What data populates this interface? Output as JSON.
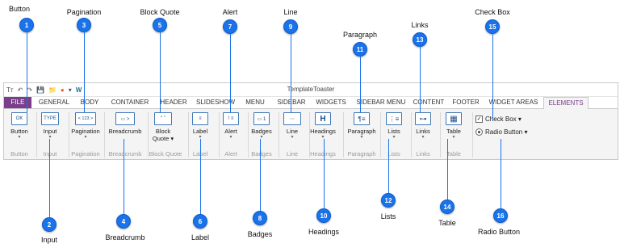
{
  "app": {
    "title": "TemplateToaster",
    "quick_access": [
      "Tт",
      "↶",
      "↷",
      "💾",
      "📁",
      "●",
      "▾",
      "W"
    ]
  },
  "tabs": [
    {
      "label": "FILE"
    },
    {
      "label": "GENERAL"
    },
    {
      "label": "BODY"
    },
    {
      "label": "CONTAINER"
    },
    {
      "label": "HEADER"
    },
    {
      "label": "SLIDESHOW"
    },
    {
      "label": "MENU"
    },
    {
      "label": "SIDEBAR"
    },
    {
      "label": "WIDGETS"
    },
    {
      "label": "SIDEBAR MENU"
    },
    {
      "label": "CONTENT"
    },
    {
      "label": "FOOTER"
    },
    {
      "label": "WIDGET AREAS"
    },
    {
      "label": "ELEMENTS"
    }
  ],
  "ribbon": {
    "button": {
      "icon": "OK",
      "label": "Button",
      "group": "Button"
    },
    "input": {
      "icon": "TYPE",
      "label": "Input",
      "group": "Input"
    },
    "pagination": {
      "icon": "< 123 >",
      "label": "Pagination",
      "group": "Pagination"
    },
    "breadcrumb": {
      "icon": "▭ >",
      "label": "Breadcrumb",
      "group": "Breadcrumb"
    },
    "blockquote": {
      "icon": "“ ”",
      "label1": "Block",
      "label2": "Quote ▾",
      "group": "Block Quote"
    },
    "label": {
      "icon": "≡",
      "label": "Label",
      "group": "Label"
    },
    "alert": {
      "icon": "! ≡",
      "label": "Alert",
      "group": "Alert"
    },
    "badges": {
      "icon": "▭ 1",
      "label": "Badges",
      "group": "Badges"
    },
    "line": {
      "icon": "⋯",
      "label": "Line",
      "group": "Line"
    },
    "headings": {
      "icon": "H",
      "label": "Headings",
      "group": "Headings"
    },
    "paragraph": {
      "icon": "¶≡",
      "label": "Paragraph",
      "group": "Paragraph"
    },
    "lists": {
      "icon": "⋮≡",
      "label": "Lists",
      "group": "Lists"
    },
    "links": {
      "icon": "⊶",
      "label": "Links",
      "group": "Links"
    },
    "table": {
      "icon": "▦",
      "label": "Table",
      "group": "Table"
    },
    "checkbox": {
      "label": "Check Box ▾"
    },
    "radio": {
      "label": "Radio Button ▾"
    }
  },
  "callouts": [
    {
      "n": "1",
      "text": "Button"
    },
    {
      "n": "2",
      "text": "Input"
    },
    {
      "n": "3",
      "text": "Pagination"
    },
    {
      "n": "4",
      "text": "Breadcrumb"
    },
    {
      "n": "5",
      "text": "Block Quote"
    },
    {
      "n": "6",
      "text": "Label"
    },
    {
      "n": "7",
      "text": "Alert"
    },
    {
      "n": "8",
      "text": "Badges"
    },
    {
      "n": "9",
      "text": "Line"
    },
    {
      "n": "10",
      "text": "Headings"
    },
    {
      "n": "11",
      "text": "Paragraph"
    },
    {
      "n": "12",
      "text": "Lists"
    },
    {
      "n": "13",
      "text": "Links"
    },
    {
      "n": "14",
      "text": "Table"
    },
    {
      "n": "15",
      "text": "Check Box"
    },
    {
      "n": "16",
      "text": "Radio Button"
    }
  ],
  "colors": {
    "accent": "#7b3e8c",
    "callout": "#1a73e8",
    "icon": "#3f78b5"
  }
}
